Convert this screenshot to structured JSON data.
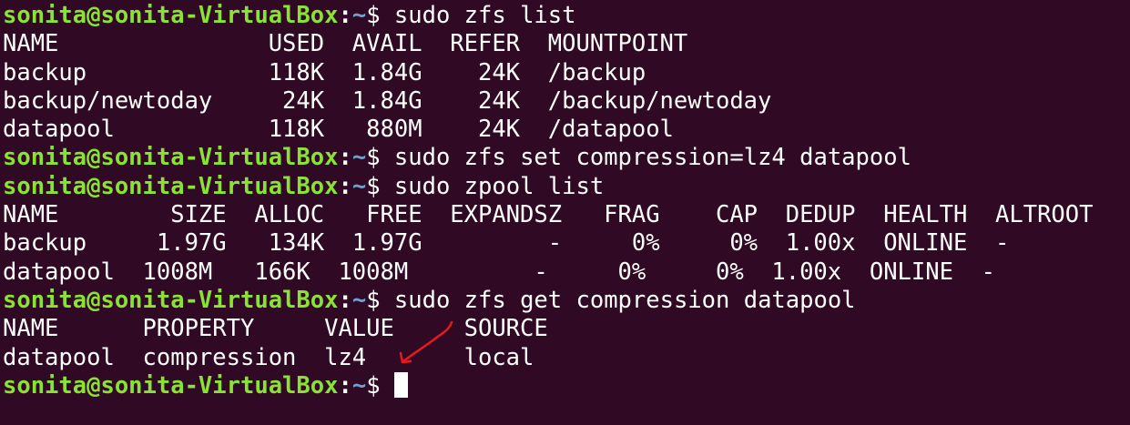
{
  "terminal": {
    "prompt": {
      "user_host": "sonita@sonita-VirtualBox",
      "colon": ":",
      "path": "~",
      "dollar": "$ "
    },
    "lines": [
      {
        "type": "prompt",
        "command": "sudo zfs list"
      },
      {
        "type": "output",
        "text": "NAME               USED  AVAIL  REFER  MOUNTPOINT"
      },
      {
        "type": "output",
        "text": "backup             118K  1.84G    24K  /backup"
      },
      {
        "type": "output",
        "text": "backup/newtoday     24K  1.84G    24K  /backup/newtoday"
      },
      {
        "type": "output",
        "text": "datapool           118K   880M    24K  /datapool"
      },
      {
        "type": "prompt",
        "command": "sudo zfs set compression=lz4 datapool"
      },
      {
        "type": "prompt",
        "command": "sudo zpool list"
      },
      {
        "type": "output",
        "text": "NAME        SIZE  ALLOC   FREE  EXPANDSZ   FRAG    CAP  DEDUP  HEALTH  ALTROOT"
      },
      {
        "type": "output",
        "text": "backup     1.97G   134K  1.97G         -     0%     0%  1.00x  ONLINE  -"
      },
      {
        "type": "output",
        "text": "datapool  1008M   166K  1008M         -     0%     0%  1.00x  ONLINE  -"
      },
      {
        "type": "prompt",
        "command": "sudo zfs get compression datapool"
      },
      {
        "type": "output",
        "text": "NAME      PROPERTY     VALUE     SOURCE"
      },
      {
        "type": "output",
        "text": "datapool  compression  lz4       local"
      },
      {
        "type": "prompt",
        "command": ""
      }
    ],
    "annotation": {
      "icon": "red-hand-drawn-arrow",
      "color": "#e8191b"
    },
    "colors": {
      "background": "#300a24",
      "user_host": "#8ae234",
      "path": "#729fcf",
      "text": "#ffffff"
    }
  }
}
